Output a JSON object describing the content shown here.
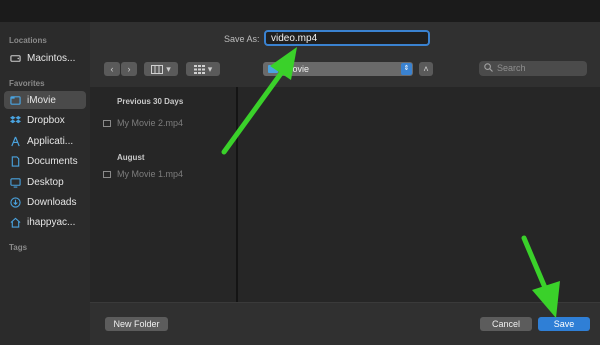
{
  "sidebar": {
    "locations_header": "Locations",
    "locations": [
      {
        "label": "Macintos...",
        "icon": "hard-drive-icon"
      }
    ],
    "favorites_header": "Favorites",
    "favorites": [
      {
        "label": "iMovie",
        "icon": "imovie-folder-icon",
        "selected": true
      },
      {
        "label": "Dropbox",
        "icon": "dropbox-icon"
      },
      {
        "label": "Applicati...",
        "icon": "applications-icon"
      },
      {
        "label": "Documents",
        "icon": "document-icon"
      },
      {
        "label": "Desktop",
        "icon": "desktop-icon"
      },
      {
        "label": "Downloads",
        "icon": "downloads-icon"
      },
      {
        "label": "ihappyac...",
        "icon": "home-icon"
      }
    ],
    "tags_header": "Tags"
  },
  "dialog": {
    "save_as_label": "Save As:",
    "filename": "video.mp4",
    "location": "iMovie",
    "search_placeholder": "Search"
  },
  "browser": {
    "groups": [
      {
        "title": "Previous 30 Days",
        "files": [
          "My Movie 2.mp4"
        ]
      },
      {
        "title": "August",
        "files": [
          "My Movie 1.mp4"
        ]
      }
    ]
  },
  "buttons": {
    "new_folder": "New Folder",
    "cancel": "Cancel",
    "save": "Save"
  },
  "colors": {
    "accent": "#2f7fd6",
    "annotation_arrow": "#3ad12a"
  }
}
